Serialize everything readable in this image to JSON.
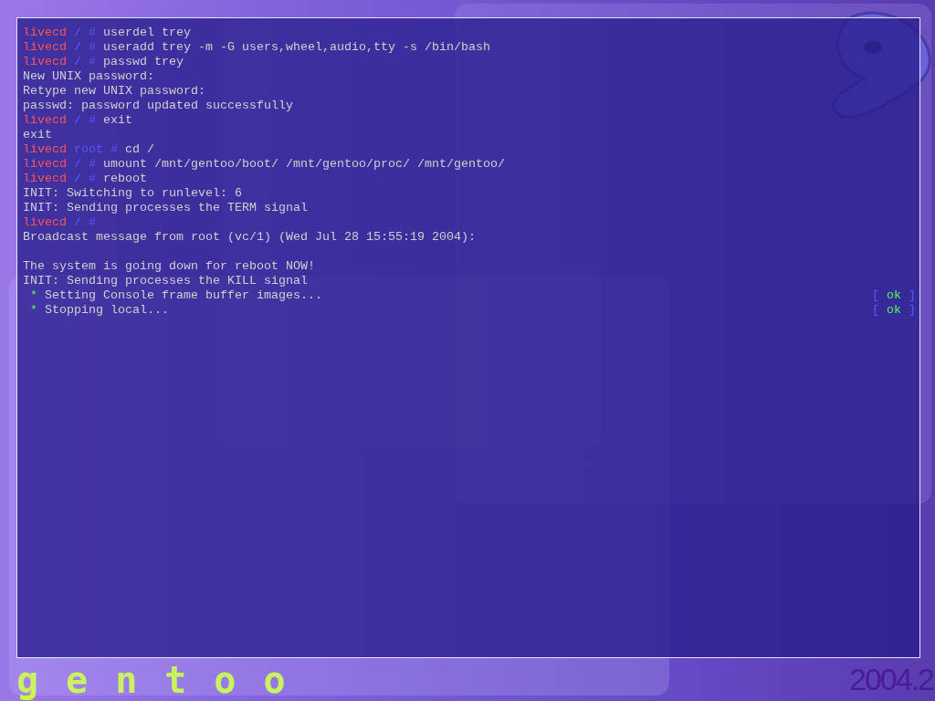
{
  "console": {
    "lines": [
      {
        "kind": "prompt",
        "host": "livecd",
        "dir": "/",
        "sign": "#",
        "command": "userdel trey"
      },
      {
        "kind": "prompt",
        "host": "livecd",
        "dir": "/",
        "sign": "#",
        "command": "useradd trey -m -G users,wheel,audio,tty -s /bin/bash"
      },
      {
        "kind": "prompt",
        "host": "livecd",
        "dir": "/",
        "sign": "#",
        "command": "passwd trey"
      },
      {
        "kind": "output",
        "text": "New UNIX password:"
      },
      {
        "kind": "output",
        "text": "Retype new UNIX password:"
      },
      {
        "kind": "output",
        "text": "passwd: password updated successfully"
      },
      {
        "kind": "prompt",
        "host": "livecd",
        "dir": "/",
        "sign": "#",
        "command": "exit"
      },
      {
        "kind": "output",
        "text": "exit"
      },
      {
        "kind": "prompt",
        "host": "livecd",
        "dir": "root",
        "sign": "#",
        "command": "cd /"
      },
      {
        "kind": "prompt",
        "host": "livecd",
        "dir": "/",
        "sign": "#",
        "command": "umount /mnt/gentoo/boot/ /mnt/gentoo/proc/ /mnt/gentoo/"
      },
      {
        "kind": "prompt",
        "host": "livecd",
        "dir": "/",
        "sign": "#",
        "command": "reboot"
      },
      {
        "kind": "output",
        "text": "INIT: Switching to runlevel: 6"
      },
      {
        "kind": "output",
        "text": "INIT: Sending processes the TERM signal"
      },
      {
        "kind": "prompt",
        "host": "livecd",
        "dir": "/",
        "sign": "#"
      },
      {
        "kind": "output",
        "text": "Broadcast message from root (vc/1) (Wed Jul 28 15:55:19 2004):"
      },
      {
        "kind": "blank"
      },
      {
        "kind": "output",
        "text": "The system is going down for reboot NOW!"
      },
      {
        "kind": "output",
        "text": "INIT: Sending processes the KILL signal"
      },
      {
        "kind": "service",
        "bullet": "*",
        "text": "Setting Console frame buffer images...",
        "open": "[",
        "status": "ok",
        "close": "]"
      },
      {
        "kind": "service",
        "bullet": "*",
        "text": "Stopping local...",
        "open": "[",
        "status": "ok",
        "close": "]"
      }
    ]
  },
  "footer": {
    "logo_text": "gentoo",
    "version": "2004.2"
  }
}
